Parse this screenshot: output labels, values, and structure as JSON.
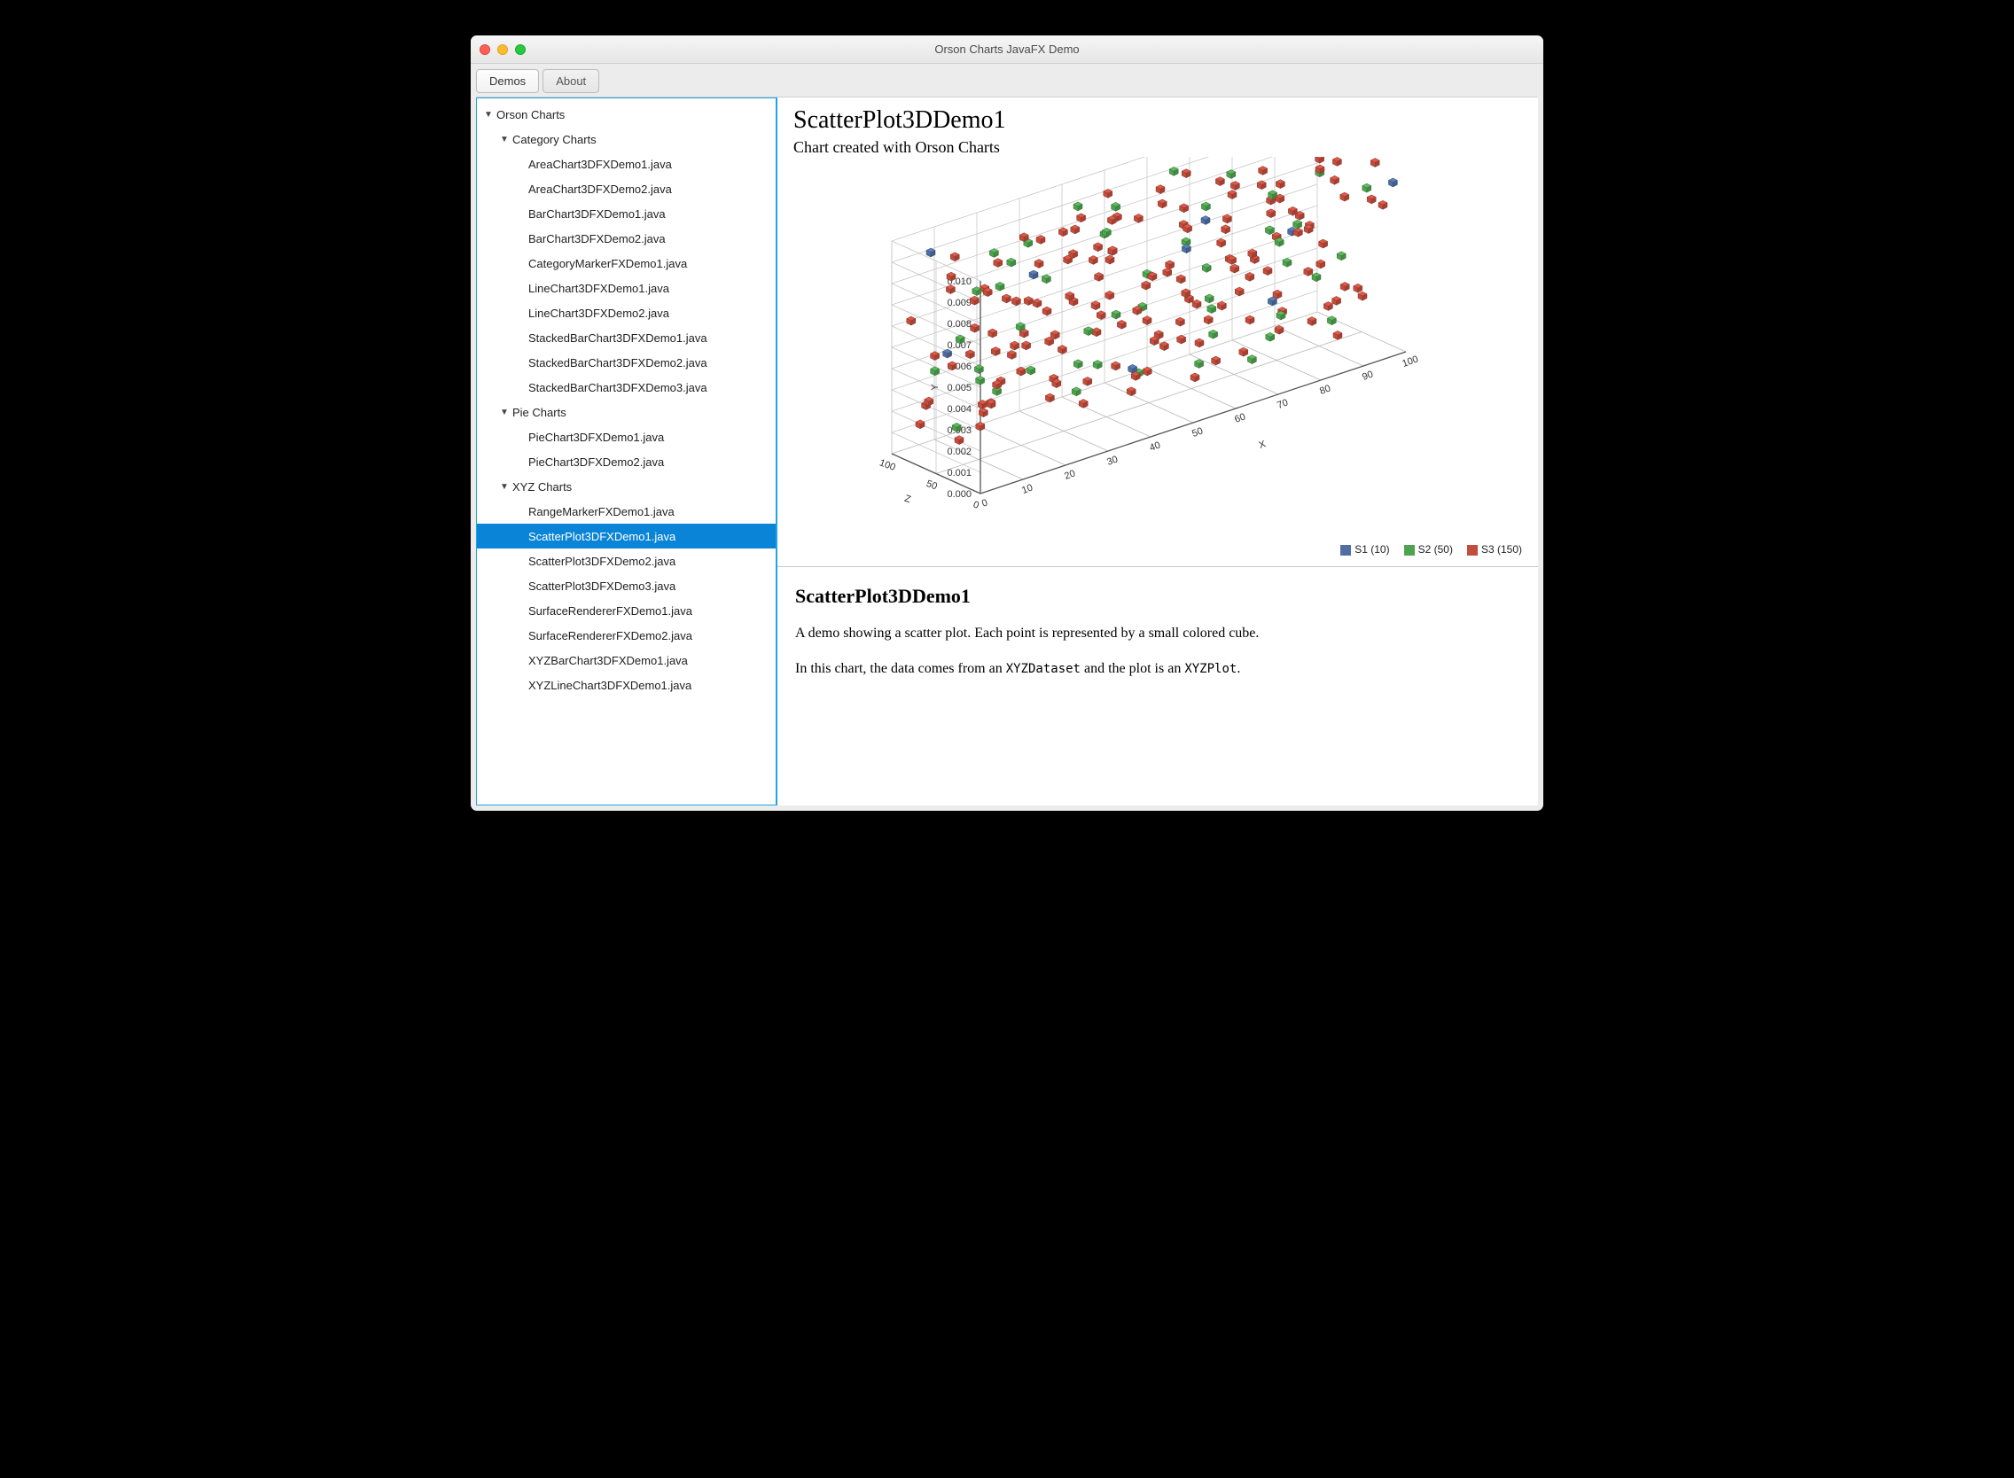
{
  "window": {
    "title": "Orson Charts JavaFX Demo"
  },
  "tabs": {
    "demos": "Demos",
    "about": "About"
  },
  "tree": {
    "root": "Orson Charts",
    "categoryGroup": "Category Charts",
    "categoryItems": [
      "AreaChart3DFXDemo1.java",
      "AreaChart3DFXDemo2.java",
      "BarChart3DFXDemo1.java",
      "BarChart3DFXDemo2.java",
      "CategoryMarkerFXDemo1.java",
      "LineChart3DFXDemo1.java",
      "LineChart3DFXDemo2.java",
      "StackedBarChart3DFXDemo1.java",
      "StackedBarChart3DFXDemo2.java",
      "StackedBarChart3DFXDemo3.java"
    ],
    "pieGroup": "Pie Charts",
    "pieItems": [
      "PieChart3DFXDemo1.java",
      "PieChart3DFXDemo2.java"
    ],
    "xyzGroup": "XYZ Charts",
    "xyzItems": [
      "RangeMarkerFXDemo1.java",
      "ScatterPlot3DFXDemo1.java",
      "ScatterPlot3DFXDemo2.java",
      "ScatterPlot3DFXDemo3.java",
      "SurfaceRendererFXDemo1.java",
      "SurfaceRendererFXDemo2.java",
      "XYZBarChart3DFXDemo1.java",
      "XYZLineChart3DFXDemo1.java"
    ],
    "selected": "ScatterPlot3DFXDemo1.java"
  },
  "chart": {
    "title": "ScatterPlot3DDemo1",
    "subtitle": "Chart created with Orson Charts",
    "axes": {
      "x": "X",
      "y": "Y",
      "z": "Z"
    },
    "xticks": [
      "0",
      "10",
      "20",
      "30",
      "40",
      "50",
      "60",
      "70",
      "80",
      "90",
      "100"
    ],
    "yticks": [
      "0.000",
      "0.001",
      "0.002",
      "0.003",
      "0.004",
      "0.005",
      "0.006",
      "0.007",
      "0.008",
      "0.009",
      "0.010"
    ],
    "zticks": [
      "0",
      "50",
      "100"
    ],
    "legend": [
      {
        "name": "S1 (10)",
        "color": "#4f6fa3"
      },
      {
        "name": "S2 (50)",
        "color": "#4fa24f"
      },
      {
        "name": "S3 (150)",
        "color": "#c24d3d"
      }
    ]
  },
  "description": {
    "heading": "ScatterPlot3DDemo1",
    "p1": "A demo showing a scatter plot. Each point is represented by a small colored cube.",
    "p2a": "In this chart, the data comes from an ",
    "p2code1": "XYZDataset",
    "p2b": " and the plot is an ",
    "p2code2": "XYZPlot",
    "p2c": "."
  },
  "chart_data": {
    "type": "scatter",
    "title": "ScatterPlot3DDemo1",
    "subtitle": "Chart created with Orson Charts",
    "xlabel": "X",
    "ylabel": "Y",
    "zlabel": "Z",
    "xlim": [
      0,
      100
    ],
    "ylim": [
      0.0,
      0.01
    ],
    "zlim": [
      0,
      100
    ],
    "series": [
      {
        "name": "S1",
        "count": 10,
        "color": "#4f6fa3",
        "points": [
          [
            5,
            0.0095,
            80
          ],
          [
            12,
            0.004,
            95
          ],
          [
            25,
            0.0075,
            60
          ],
          [
            42,
            0.0025,
            30
          ],
          [
            55,
            0.009,
            10
          ],
          [
            63,
            0.006,
            70
          ],
          [
            78,
            0.003,
            45
          ],
          [
            85,
            0.01,
            20
          ],
          [
            92,
            0.0045,
            90
          ],
          [
            98,
            0.008,
            5
          ]
        ]
      },
      {
        "name": "S2",
        "count": 50,
        "color": "#4fa24f",
        "points": [
          [
            2,
            0.005,
            10
          ],
          [
            6,
            0.0085,
            33
          ],
          [
            9,
            0.0012,
            70
          ],
          [
            14,
            0.0065,
            22
          ],
          [
            18,
            0.003,
            88
          ],
          [
            21,
            0.0095,
            47
          ],
          [
            24,
            0.0044,
            5
          ],
          [
            28,
            0.0071,
            60
          ],
          [
            31,
            0.002,
            92
          ],
          [
            35,
            0.0058,
            15
          ],
          [
            38,
            0.009,
            40
          ],
          [
            41,
            0.0035,
            75
          ],
          [
            45,
            0.0068,
            28
          ],
          [
            48,
            0.0015,
            52
          ],
          [
            52,
            0.0082,
            97
          ],
          [
            56,
            0.0048,
            8
          ],
          [
            59,
            0.01,
            65
          ],
          [
            62,
            0.0027,
            35
          ],
          [
            65,
            0.006,
            80
          ],
          [
            68,
            0.0014,
            20
          ],
          [
            71,
            0.0092,
            58
          ],
          [
            74,
            0.0038,
            100
          ],
          [
            77,
            0.0073,
            12
          ],
          [
            80,
            0.0022,
            45
          ],
          [
            83,
            0.0055,
            72
          ],
          [
            86,
            0.0088,
            30
          ],
          [
            89,
            0.0042,
            90
          ],
          [
            93,
            0.001,
            50
          ],
          [
            96,
            0.0075,
            25
          ],
          [
            99,
            0.0033,
            68
          ],
          [
            4,
            0.0062,
            42
          ],
          [
            11,
            0.0098,
            18
          ],
          [
            17,
            0.0025,
            63
          ],
          [
            23,
            0.008,
            95
          ],
          [
            29,
            0.004,
            7
          ],
          [
            34,
            0.0015,
            55
          ],
          [
            40,
            0.0093,
            82
          ],
          [
            46,
            0.005,
            38
          ],
          [
            50,
            0.007,
            100
          ],
          [
            57,
            0.0018,
            27
          ],
          [
            63,
            0.0084,
            48
          ],
          [
            69,
            0.0032,
            73
          ],
          [
            75,
            0.0056,
            14
          ],
          [
            81,
            0.0008,
            62
          ],
          [
            87,
            0.0066,
            88
          ],
          [
            91,
            0.01,
            3
          ],
          [
            95,
            0.0024,
            77
          ],
          [
            100,
            0.009,
            35
          ],
          [
            7,
            0.0037,
            85
          ],
          [
            15,
            0.0078,
            50
          ]
        ]
      },
      {
        "name": "S3",
        "count": 150,
        "color": "#c24d3d",
        "points": [
          [
            1,
            0.003,
            5
          ],
          [
            3,
            0.0085,
            48
          ],
          [
            5,
            0.0012,
            92
          ],
          [
            7,
            0.0067,
            20
          ],
          [
            9,
            0.004,
            75
          ],
          [
            11,
            0.0095,
            33
          ],
          [
            13,
            0.0022,
            60
          ],
          [
            15,
            0.0078,
            8
          ],
          [
            17,
            0.005,
            88
          ],
          [
            19,
            0.01,
            42
          ],
          [
            21,
            0.0035,
            15
          ],
          [
            23,
            0.0062,
            70
          ],
          [
            25,
            0.0018,
            97
          ],
          [
            27,
            0.009,
            25
          ],
          [
            29,
            0.0045,
            55
          ],
          [
            31,
            0.0072,
            3
          ],
          [
            33,
            0.0008,
            80
          ],
          [
            35,
            0.0058,
            38
          ],
          [
            37,
            0.0093,
            64
          ],
          [
            39,
            0.0027,
            12
          ],
          [
            41,
            0.008,
            90
          ],
          [
            43,
            0.0042,
            47
          ],
          [
            45,
            0.0068,
            22
          ],
          [
            47,
            0.0015,
            73
          ],
          [
            49,
            0.0098,
            30
          ],
          [
            51,
            0.0053,
            58
          ],
          [
            53,
            0.0076,
            100
          ],
          [
            55,
            0.0031,
            17
          ],
          [
            57,
            0.0088,
            44
          ],
          [
            59,
            0.002,
            82
          ],
          [
            61,
            0.0064,
            6
          ],
          [
            63,
            0.0037,
            67
          ],
          [
            65,
            0.0092,
            28
          ],
          [
            67,
            0.001,
            95
          ],
          [
            69,
            0.0055,
            50
          ],
          [
            71,
            0.0082,
            13
          ],
          [
            73,
            0.0025,
            78
          ],
          [
            75,
            0.0048,
            36
          ],
          [
            77,
            0.01,
            62
          ],
          [
            79,
            0.007,
            9
          ],
          [
            81,
            0.0032,
            85
          ],
          [
            83,
            0.006,
            40
          ],
          [
            85,
            0.0007,
            71
          ],
          [
            87,
            0.0086,
            18
          ],
          [
            89,
            0.0044,
            93
          ],
          [
            91,
            0.0074,
            26
          ],
          [
            93,
            0.0016,
            54
          ],
          [
            95,
            0.0098,
            2
          ],
          [
            97,
            0.0038,
            79
          ],
          [
            99,
            0.0066,
            34
          ],
          [
            2,
            0.0052,
            61
          ],
          [
            4,
            0.009,
            11
          ],
          [
            6,
            0.0023,
            87
          ],
          [
            8,
            0.0077,
            45
          ],
          [
            10,
            0.0005,
            72
          ],
          [
            12,
            0.0058,
            19
          ],
          [
            14,
            0.0084,
            96
          ],
          [
            16,
            0.0041,
            31
          ],
          [
            18,
            0.0069,
            57
          ],
          [
            20,
            0.0013,
            84
          ],
          [
            22,
            0.0094,
            7
          ],
          [
            24,
            0.0047,
            66
          ],
          [
            26,
            0.0071,
            24
          ],
          [
            28,
            0.0028,
            99
          ],
          [
            30,
            0.0063,
            39
          ],
          [
            32,
            0.0036,
            76
          ],
          [
            34,
            0.0089,
            14
          ],
          [
            36,
            0.0019,
            52
          ],
          [
            38,
            0.0081,
            89
          ],
          [
            40,
            0.0054,
            4
          ],
          [
            42,
            0.0075,
            69
          ],
          [
            44,
            0.0011,
            41
          ],
          [
            46,
            0.0096,
            77
          ],
          [
            48,
            0.0033,
            23
          ],
          [
            50,
            0.0059,
            94
          ],
          [
            52,
            0.0087,
            16
          ],
          [
            54,
            0.0024,
            63
          ],
          [
            56,
            0.005,
            37
          ],
          [
            58,
            0.0072,
            100
          ],
          [
            60,
            0.0006,
            46
          ],
          [
            62,
            0.0079,
            21
          ],
          [
            64,
            0.0043,
            81
          ],
          [
            66,
            0.0067,
            10
          ],
          [
            68,
            0.0091,
            56
          ],
          [
            70,
            0.0029,
            32
          ],
          [
            72,
            0.0056,
            74
          ],
          [
            74,
            0.0014,
            98
          ],
          [
            76,
            0.0083,
            27
          ],
          [
            78,
            0.0046,
            65
          ],
          [
            80,
            0.0099,
            1
          ],
          [
            82,
            0.0021,
            53
          ],
          [
            84,
            0.0073,
            86
          ],
          [
            86,
            0.0039,
            43
          ],
          [
            88,
            0.0061,
            70
          ],
          [
            90,
            0.0009,
            29
          ],
          [
            92,
            0.0085,
            59
          ],
          [
            94,
            0.0051,
            91
          ],
          [
            96,
            0.0026,
            35
          ],
          [
            98,
            0.0078,
            68
          ],
          [
            100,
            0.0017,
            49
          ],
          [
            1,
            0.0065,
            83
          ],
          [
            3,
            0.0034,
            11
          ],
          [
            5,
            0.0088,
            57
          ],
          [
            7,
            0.0019,
            95
          ],
          [
            9,
            0.0056,
            26
          ],
          [
            11,
            0.008,
            48
          ],
          [
            13,
            0.0043,
            74
          ],
          [
            15,
            0.0097,
            6
          ],
          [
            17,
            0.0028,
            63
          ],
          [
            19,
            0.0071,
            37
          ],
          [
            21,
            0.0012,
            89
          ],
          [
            23,
            0.0049,
            18
          ],
          [
            25,
            0.0093,
            52
          ],
          [
            27,
            0.0037,
            78
          ],
          [
            29,
            0.0064,
            3
          ],
          [
            31,
            0.0021,
            66
          ],
          [
            33,
            0.0082,
            31
          ],
          [
            35,
            0.0045,
            93
          ],
          [
            37,
            0.0069,
            44
          ],
          [
            39,
            0.0003,
            71
          ],
          [
            41,
            0.0055,
            20
          ],
          [
            43,
            0.0089,
            58
          ],
          [
            45,
            0.003,
            85
          ],
          [
            47,
            0.0074,
            12
          ],
          [
            49,
            0.0016,
            47
          ],
          [
            51,
            0.0062,
            96
          ],
          [
            53,
            0.004,
            29
          ],
          [
            55,
            0.0095,
            61
          ],
          [
            57,
            0.0023,
            8
          ],
          [
            59,
            0.0077,
            54
          ],
          [
            61,
            0.0048,
            82
          ],
          [
            63,
            0.01,
            15
          ],
          [
            65,
            0.0033,
            68
          ],
          [
            67,
            0.0058,
            38
          ],
          [
            69,
            0.0086,
            99
          ],
          [
            71,
            0.0011,
            44
          ],
          [
            73,
            0.0067,
            72
          ],
          [
            75,
            0.0039,
            25
          ],
          [
            77,
            0.0091,
            51
          ],
          [
            79,
            0.0026,
            87
          ],
          [
            81,
            0.0053,
            5
          ],
          [
            83,
            0.0079,
            60
          ],
          [
            85,
            0.0018,
            34
          ],
          [
            87,
            0.0063,
            90
          ],
          [
            89,
            0.0035,
            16
          ],
          [
            91,
            0.0098,
            42
          ],
          [
            93,
            0.005,
            75
          ],
          [
            95,
            0.0072,
            2
          ],
          [
            97,
            0.0014,
            64
          ],
          [
            99,
            0.0084,
            30
          ]
        ]
      }
    ]
  }
}
